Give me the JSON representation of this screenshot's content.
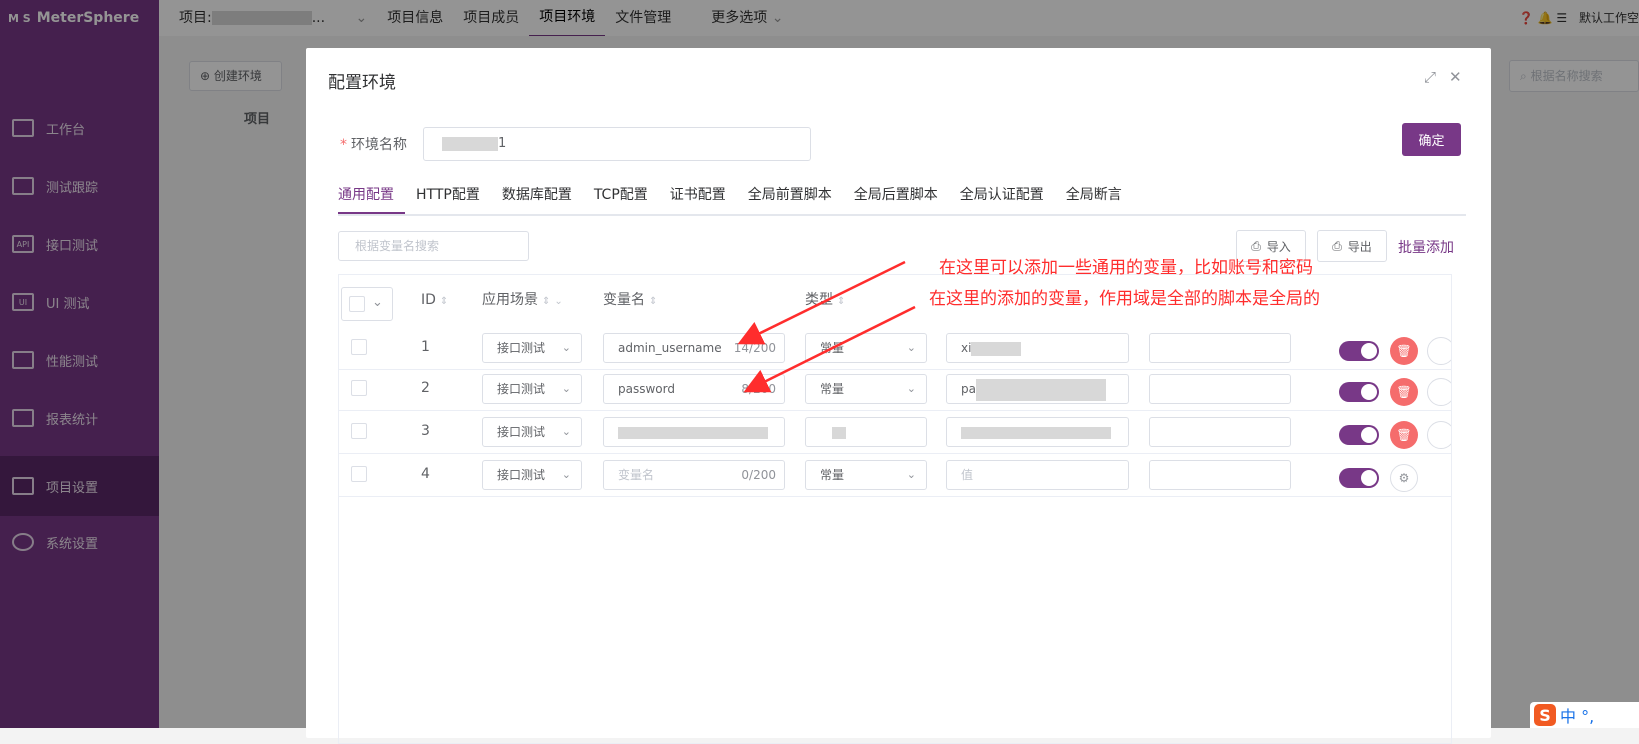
{
  "sidebar": {
    "logo": "MeterSphere",
    "logo_mark": "M S",
    "items": [
      {
        "label": "工作台",
        "icon": "monitor-icon"
      },
      {
        "label": "测试跟踪",
        "icon": "clipboard-icon"
      },
      {
        "label": "接口测试",
        "icon": "api-icon"
      },
      {
        "label": "UI 测试",
        "icon": "ui-icon"
      },
      {
        "label": "性能测试",
        "icon": "performance-icon"
      },
      {
        "label": "报表统计",
        "icon": "report-icon"
      },
      {
        "label": "项目设置",
        "icon": "folder-settings-icon"
      },
      {
        "label": "系统设置",
        "icon": "gears-icon"
      }
    ],
    "active_index": 6
  },
  "topbar": {
    "project_prefix": "项目:",
    "project_suffix": "...",
    "items": [
      "项目信息",
      "项目成员",
      "项目环境",
      "文件管理",
      "更多选项"
    ],
    "active": "项目环境",
    "right_text": "默认工作空"
  },
  "background": {
    "create_env": "创建环境",
    "column_project": "项目",
    "search_placeholder": "根据名称搜索"
  },
  "dialog": {
    "title": "配置环境",
    "env_name_label": "环境名称",
    "env_name_value_suffix": "1",
    "confirm": "确定",
    "tabs": [
      "通用配置",
      "HTTP配置",
      "数据库配置",
      "TCP配置",
      "证书配置",
      "全局前置脚本",
      "全局后置脚本",
      "全局认证配置",
      "全局断言"
    ],
    "var_search_placeholder": "根据变量名搜索",
    "import": "导入",
    "export": "导出",
    "batch_add": "批量添加",
    "columns": {
      "id": "ID",
      "scene": "应用场景",
      "name": "变量名",
      "type": "类型"
    },
    "rows": [
      {
        "id": "1",
        "scene": "接口测试",
        "name": "admin_username",
        "count": "14/200",
        "type": "常量",
        "value": "xi",
        "enabled": true
      },
      {
        "id": "2",
        "scene": "接口测试",
        "name": "password",
        "count": "8/200",
        "type": "常量",
        "value": "pa",
        "enabled": true
      },
      {
        "id": "3",
        "scene": "接口测试",
        "name": "",
        "count": "",
        "type": "",
        "value": "",
        "enabled": true
      },
      {
        "id": "4",
        "scene": "接口测试",
        "name_placeholder": "变量名",
        "count": "0/200",
        "type": "常量",
        "value_placeholder": "值",
        "enabled": true
      }
    ]
  },
  "annotations": {
    "line1": "在这里可以添加一些通用的变量，比如账号和密码",
    "line2": "在这里的添加的变量，作用域是全部的脚本是全局的",
    "color": "#ff2d2d"
  },
  "ime": {
    "label": "中 °,"
  },
  "colors": {
    "brand": "#783887",
    "danger": "#f56c6c"
  }
}
